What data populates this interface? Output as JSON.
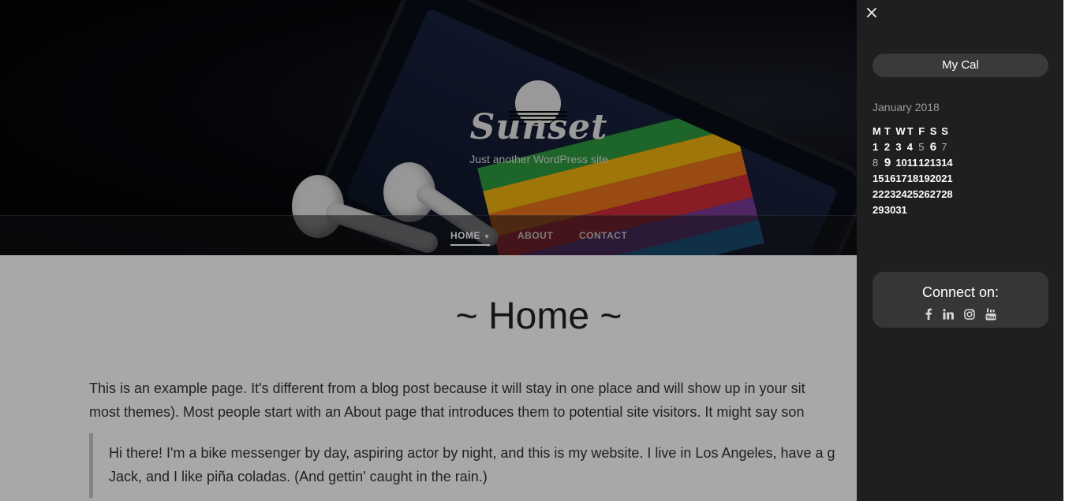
{
  "site": {
    "title": "Sunset",
    "tagline": "Just another WordPress site"
  },
  "nav": {
    "items": [
      {
        "label": "HOME",
        "active": true
      },
      {
        "label": "ABOUT",
        "active": false
      },
      {
        "label": "CONTACT",
        "active": false
      }
    ],
    "caret": "▼"
  },
  "page": {
    "title": "~ Home ~",
    "paragraph_line1": "This is an example page. It's different from a blog post because it will stay in one place and will show up in your sit",
    "paragraph_line2": "most themes). Most people start with an About page that introduces them to potential site visitors. It might say son",
    "quote_line1": "Hi there! I'm a bike messenger by day, aspiring actor by night, and this is my website. I live in Los Angeles, have a g",
    "quote_line2": "Jack, and I like piña coladas. (And gettin' caught in the rain.)"
  },
  "sidebar": {
    "close_icon": "×",
    "calendar_widget_title": "My Cal",
    "calendar_caption": "January 2018",
    "weekdays": [
      "M",
      "T",
      "W",
      "T",
      "F",
      "S",
      "S"
    ],
    "weeks": [
      [
        "1",
        "2",
        "3",
        "4",
        "5",
        "6",
        "7"
      ],
      [
        "8",
        "9",
        "10",
        "11",
        "12",
        "13",
        "14"
      ],
      [
        "15",
        "16",
        "17",
        "18",
        "19",
        "20",
        "21"
      ],
      [
        "22",
        "23",
        "24",
        "25",
        "26",
        "27",
        "28"
      ],
      [
        "29",
        "30",
        "31",
        "",
        "",
        "",
        ""
      ]
    ],
    "connect_title": "Connect on:",
    "social_icons": [
      "facebook-icon",
      "linkedin-icon",
      "instagram-icon",
      "youtube-icon"
    ]
  },
  "colors": {
    "panel_bg": "#1f1f1f",
    "widget_bg": "#3a3a3a",
    "overlay": "rgba(0,0,0,0.34)"
  }
}
